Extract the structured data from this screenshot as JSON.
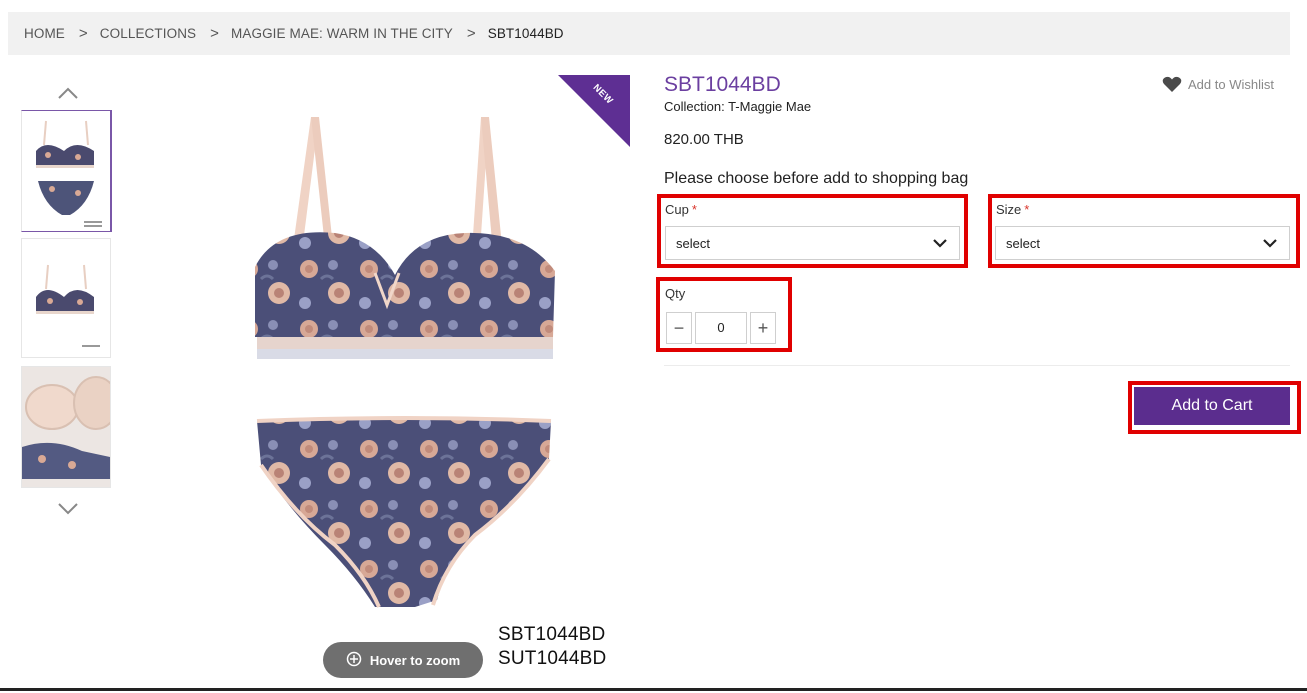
{
  "breadcrumb": {
    "items": [
      "HOME",
      "COLLECTIONS",
      "MAGGIE MAE: WARM IN THE CITY",
      "SBT1044BD"
    ],
    "separator": ">"
  },
  "gallery": {
    "thumbnails": [
      "thumbnail-set",
      "thumbnail-bra",
      "thumbnail-detail"
    ],
    "badge": "NEW",
    "style_codes": [
      "SBT1044BD",
      "SUT1044BD"
    ],
    "zoom_label": "Hover to zoom"
  },
  "product": {
    "title": "SBT1044BD",
    "collection": "Collection: T-Maggie Mae",
    "price": "820.00 THB",
    "wishlist_label": "Add to Wishlist",
    "instructions": "Please choose before add to shopping bag"
  },
  "options": {
    "cup": {
      "label": "Cup",
      "required": "*",
      "value": "select"
    },
    "size": {
      "label": "Size",
      "required": "*",
      "value": "select"
    },
    "qty": {
      "label": "Qty",
      "value": "0",
      "minus": "−",
      "plus": "+"
    }
  },
  "cart": {
    "button_label": "Add to Cart"
  },
  "colors": {
    "brand_purple": "#5b2d8e",
    "title_purple": "#6b3fa0",
    "highlight_red": "#e00000",
    "breadcrumb_bg": "#f1f1f1"
  }
}
